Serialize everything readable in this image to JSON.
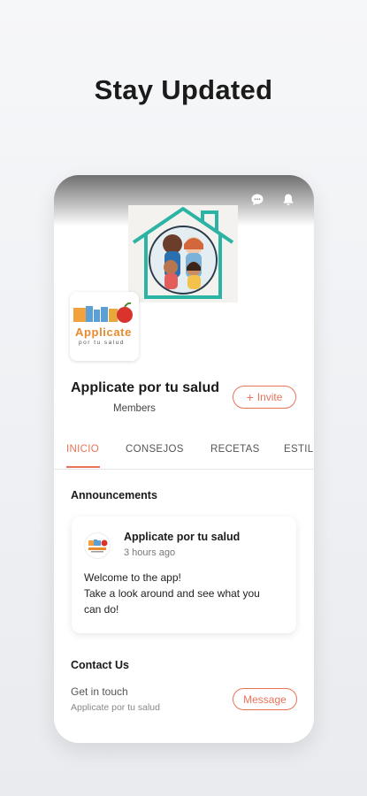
{
  "headline": "Stay Updated",
  "topbar": {
    "icons": [
      "chat-icon",
      "bell-icon"
    ]
  },
  "group": {
    "name": "Applicate por tu salud",
    "members_label": "Members",
    "invite_label": "Invite",
    "logo_text_line1": "Applicate",
    "logo_text_line2": "por tu salud"
  },
  "tabs": [
    {
      "label": "INICIO",
      "active": true
    },
    {
      "label": "CONSEJOS",
      "active": false
    },
    {
      "label": "RECETAS",
      "active": false
    },
    {
      "label": "ESTILO",
      "active": false
    }
  ],
  "announcements": {
    "title": "Announcements",
    "post": {
      "author": "Applicate por tu salud",
      "time": "3 hours ago",
      "lines": [
        "Welcome to the app!",
        "Take a look around and see what you",
        "can do!"
      ]
    }
  },
  "contact": {
    "title": "Contact Us",
    "line1": "Get in touch",
    "line2": "Applicate por tu salud",
    "button": "Message"
  },
  "colors": {
    "accent": "#e8735a",
    "house": "#2bb3a3"
  }
}
